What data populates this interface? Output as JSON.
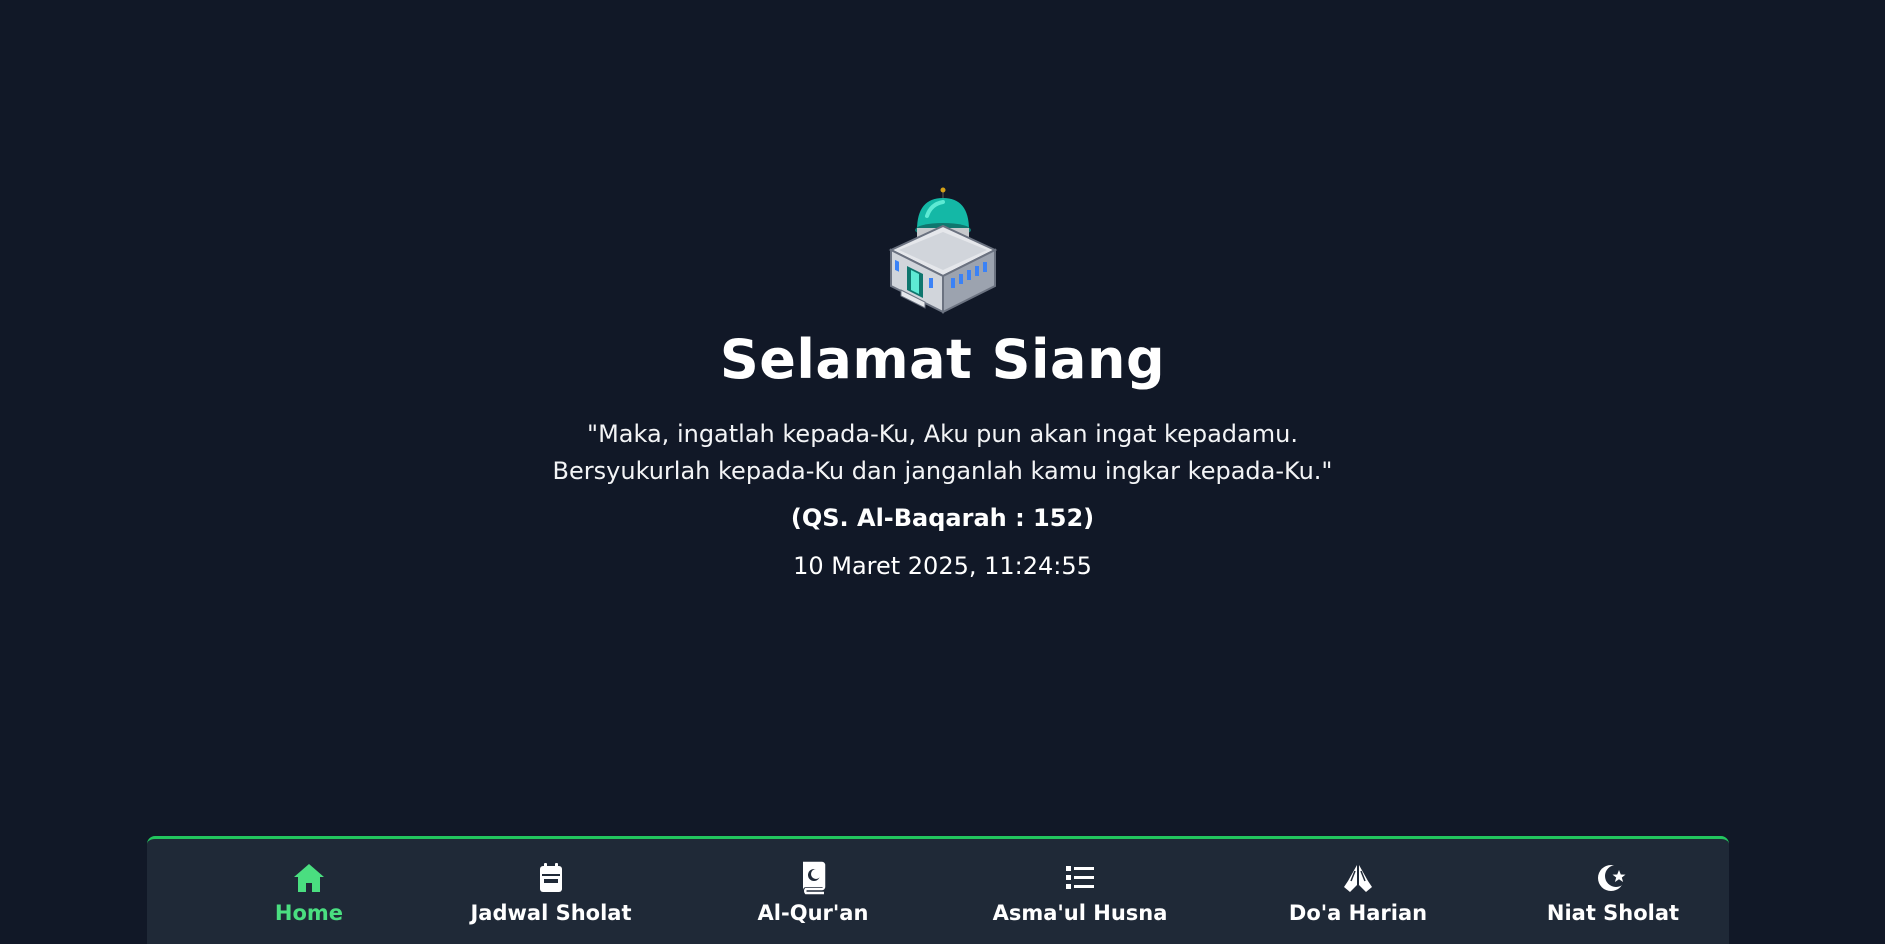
{
  "hero": {
    "greeting": "Selamat Siang",
    "quote_line1": "\"Maka, ingatlah kepada-Ku, Aku pun akan ingat kepadamu.",
    "quote_line2": "Bersyukurlah kepada-Ku dan janganlah kamu ingkar kepada-Ku.\"",
    "source": "(QS. Al-Baqarah : 152)",
    "datetime": "10 Maret 2025, 11:24:55"
  },
  "nav": {
    "items": [
      {
        "label": "Home",
        "icon": "home-icon",
        "active": true
      },
      {
        "label": "Jadwal Sholat",
        "icon": "calendar-icon",
        "active": false
      },
      {
        "label": "Al-Qur'an",
        "icon": "quran-icon",
        "active": false
      },
      {
        "label": "Asma'ul Husna",
        "icon": "list-icon",
        "active": false
      },
      {
        "label": "Do'a Harian",
        "icon": "praying-hands-icon",
        "active": false
      },
      {
        "label": "Niat Sholat",
        "icon": "star-and-crescent-icon",
        "active": false
      }
    ]
  },
  "colors": {
    "background": "#111827",
    "nav_background": "#1f2937",
    "accent": "#22c55e",
    "active_label": "#4ade80",
    "text": "#ffffff"
  }
}
